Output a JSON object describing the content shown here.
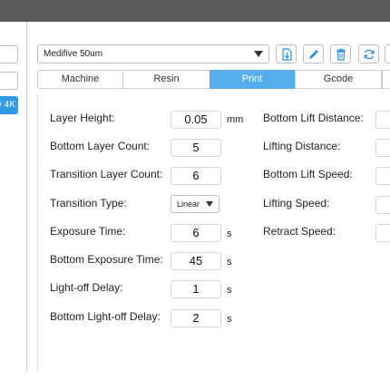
{
  "left_panel": {
    "selected_item": "y 4K"
  },
  "profile": {
    "selected": "Medifive 50um"
  },
  "toolbar": {
    "icons": [
      "export-icon",
      "edit-icon",
      "delete-icon",
      "refresh-icon"
    ]
  },
  "tabs": [
    {
      "label": "Machine"
    },
    {
      "label": "Resin"
    },
    {
      "label": "Print"
    },
    {
      "label": "Gcode"
    }
  ],
  "active_tab": "Print",
  "settings_left": [
    {
      "label": "Layer Height:",
      "value": "0.05",
      "unit": "mm"
    },
    {
      "label": "Bottom Layer Count:",
      "value": "5",
      "unit": ""
    },
    {
      "label": "Transition Layer Count:",
      "value": "6",
      "unit": ""
    },
    {
      "label": "Transition Type:",
      "value": "Linear",
      "unit": ""
    },
    {
      "label": "Exposure Time:",
      "value": "6",
      "unit": "s"
    },
    {
      "label": "Bottom Exposure Time:",
      "value": "45",
      "unit": "s"
    },
    {
      "label": "Light-off Delay:",
      "value": "1",
      "unit": "s"
    },
    {
      "label": "Bottom Light-off Delay:",
      "value": "2",
      "unit": "s"
    }
  ],
  "settings_right": [
    {
      "label": "Bottom Lift Distance:"
    },
    {
      "label": "Lifting Distance:"
    },
    {
      "label": "Bottom Lift Speed:"
    },
    {
      "label": "Lifting Speed:"
    },
    {
      "label": "Retract Speed:"
    }
  ]
}
